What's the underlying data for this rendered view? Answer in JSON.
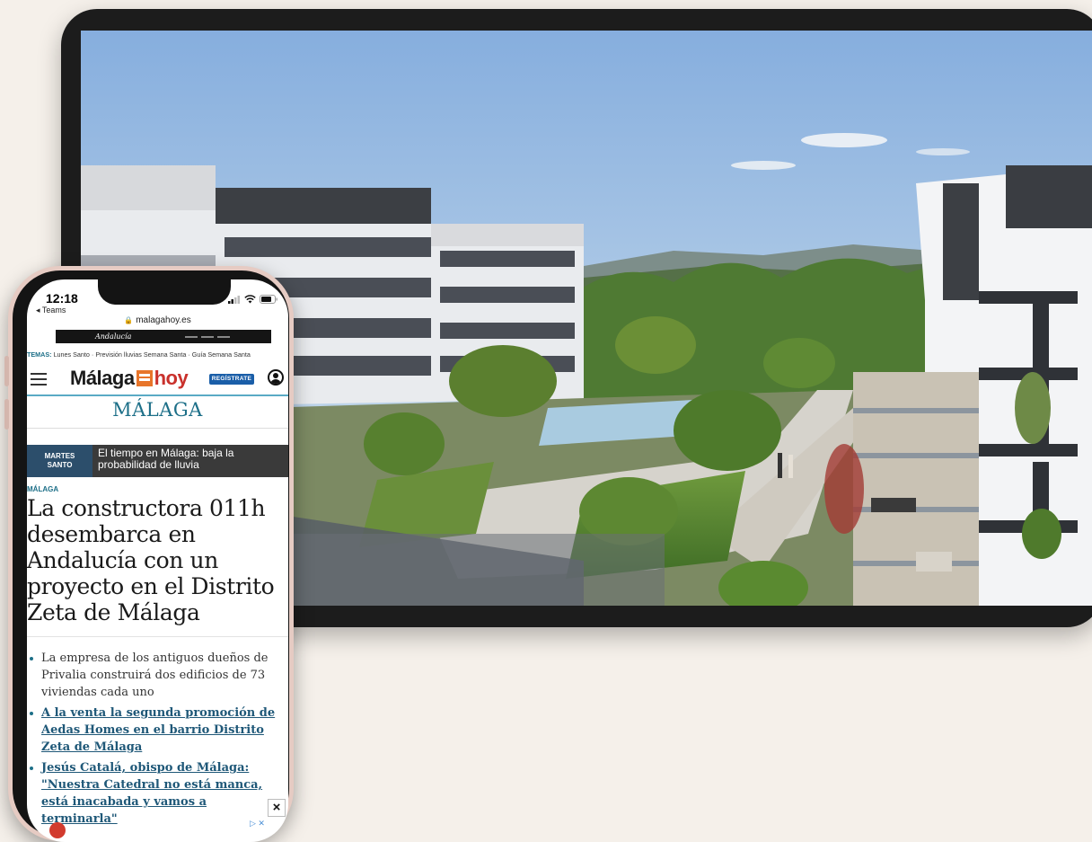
{
  "phone": {
    "time": "12:18",
    "back_app": "◂ Teams",
    "url": "malagahoy.es",
    "ad_script": "Andalucía",
    "topics_label": "TEMAS:",
    "topics": "Lunes Santo · Previsión lluvias Semana Santa · Guía Semana Santa",
    "logo_part1": "Málaga",
    "logo_part2": "hoy",
    "register": "REGÍSTRATE",
    "section": "MÁLAGA",
    "breaking_tag_line1": "MARTES",
    "breaking_tag_line2": "SANTO",
    "breaking_headline": "El tiempo en Málaga: baja la probabilidad de lluvia",
    "category": "MÁLAGA",
    "title": "La constructora 011h desembarca en Andalucía con un proyecto en el Distrito Zeta de Málaga",
    "bullets": [
      "La empresa de los antiguos dueños de Privalia construirá dos edificios de 73 viviendas cada uno",
      "A la venta la segunda promoción de Aedas Homes en el barrio Distrito Zeta de Málaga",
      "Jesús Catalá, obispo de Málaga: \"Nuestra Catedral no está manca, está inacabada y vamos a terminarla\""
    ],
    "ad_close": "×",
    "adchoices": "▷ ✕"
  },
  "colors": {
    "accent": "#1d6f88",
    "brand_orange": "#e8752a",
    "brand_red": "#c9312c",
    "register_blue": "#1a5ea8",
    "breaking_tag": "#2c4e6b"
  }
}
